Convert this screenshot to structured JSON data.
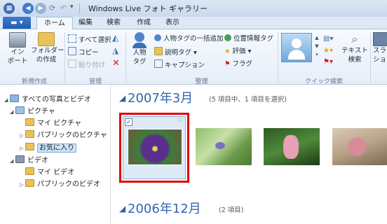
{
  "window": {
    "title": "Windows Live フォト ギャラリー"
  },
  "tabs": [
    {
      "label": "ホーム"
    },
    {
      "label": "編集"
    },
    {
      "label": "検索"
    },
    {
      "label": "作成"
    },
    {
      "label": "表示"
    }
  ],
  "ribbon": {
    "import_label_1": "イン",
    "import_label_2": "ポート",
    "folder_label_1": "フォルダー",
    "folder_label_2": "の作成",
    "group_new": "新規作成",
    "select_all": "すべて選択",
    "copy": "コピー",
    "paste": "貼り付け",
    "group_manage": "管理",
    "people_tag_1": "人物",
    "people_tag_2": "タグ",
    "bulk_people_tag": "人物タグの一括追加",
    "description_tag": "説明タグ",
    "caption": "キャプション",
    "geotag": "位置情報タグ",
    "rating": "評価",
    "flag": "フラグ",
    "group_organize": "整理",
    "group_quick_search": "クイック検索",
    "text_search_1": "テキスト",
    "text_search_2": "検索",
    "slideshow_1": "スライ",
    "slideshow_2": "ショー"
  },
  "nav": {
    "items": [
      {
        "label": "すべての写真とビデオ"
      },
      {
        "label": "ピクチャ"
      },
      {
        "label": "マイ ピクチャ"
      },
      {
        "label": "パブリックのピクチャ"
      },
      {
        "label": "お気に入り"
      },
      {
        "label": "ビデオ"
      },
      {
        "label": "マイ ビデオ"
      },
      {
        "label": "パブリックのビデオ"
      }
    ]
  },
  "groups": [
    {
      "date": "2007年3月",
      "count": "(5 項目中、1 項目を選択)"
    },
    {
      "date": "2006年12月",
      "count": "(2 項目)"
    }
  ],
  "colors": {
    "accent": "#3366aa",
    "selection_outline": "#e00000",
    "file_tab": "#1f5db0"
  }
}
